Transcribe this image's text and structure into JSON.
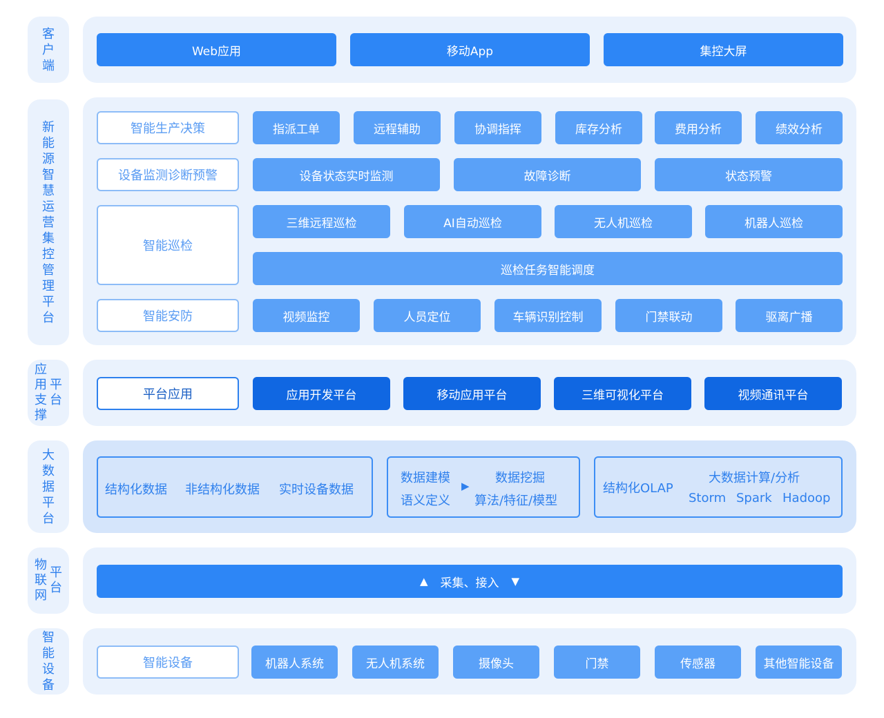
{
  "layers": {
    "client": "客户端",
    "ops": "新能源智慧运营集控管理平台",
    "app_support_a": "应用支撑",
    "app_support_b": "平台",
    "bigdata": "大数据平台",
    "iot_a": "物联网",
    "iot_b": "平台",
    "devices": "智能设备"
  },
  "client": {
    "items": [
      "Web应用",
      "移动App",
      "集控大屏"
    ]
  },
  "ops": {
    "production": {
      "label": "智能生产决策",
      "items": [
        "指派工单",
        "远程辅助",
        "协调指挥",
        "库存分析",
        "费用分析",
        "绩效分析"
      ]
    },
    "monitoring": {
      "label": "设备监测诊断预警",
      "items": [
        "设备状态实时监测",
        "故障诊断",
        "状态预警"
      ]
    },
    "inspection": {
      "label": "智能巡检",
      "items": [
        "三维远程巡检",
        "AI自动巡检",
        "无人机巡检",
        "机器人巡检"
      ],
      "scheduling": "巡检任务智能调度"
    },
    "security": {
      "label": "智能安防",
      "items": [
        "视频监控",
        "人员定位",
        "车辆识别控制",
        "门禁联动",
        "驱离广播"
      ]
    }
  },
  "app_support": {
    "label": "平台应用",
    "items": [
      "应用开发平台",
      "移动应用平台",
      "三维可视化平台",
      "视频通讯平台"
    ]
  },
  "bigdata": {
    "box1": [
      "结构化数据",
      "非结构化数据",
      "实时设备数据"
    ],
    "box2": {
      "top_left": "数据建模",
      "bottom_left": "语义定义",
      "arrow": "▶",
      "top_right": "数据挖掘",
      "bottom_right": "算法/特征/模型"
    },
    "box3": {
      "left": "结构化OLAP",
      "top": "大数据计算/分析",
      "bottom": [
        "Storm",
        "Spark",
        "Hadoop"
      ]
    }
  },
  "iot": {
    "up_arrow": "▲",
    "label": "采集、接入",
    "down_arrow": "▼"
  },
  "devices": {
    "label": "智能设备",
    "items": [
      "机器人系统",
      "无人机系统",
      "摄像头",
      "门禁",
      "传感器",
      "其他智能设备"
    ]
  }
}
